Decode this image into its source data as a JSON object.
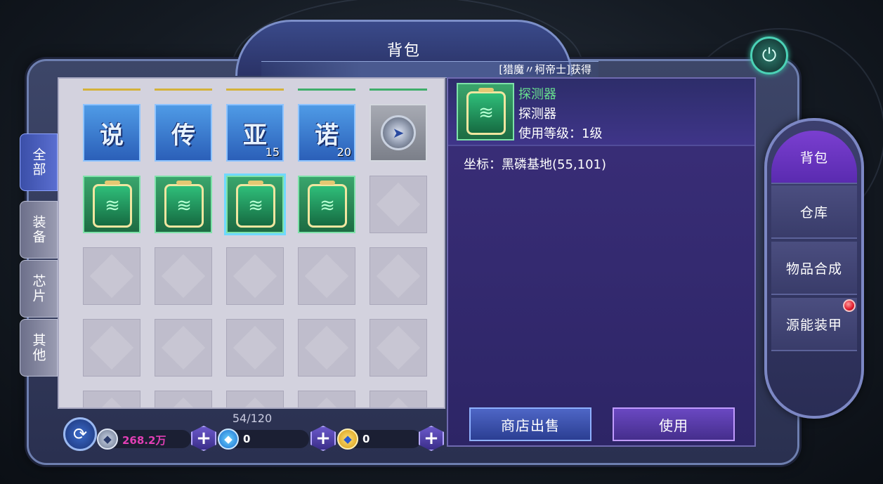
{
  "window": {
    "title": "背包"
  },
  "news_ticker": "[猎魔〃柯帝士]获得",
  "tabs": [
    {
      "label": "全部",
      "active": true
    },
    {
      "label": "装备",
      "active": false
    },
    {
      "label": "芯片",
      "active": false
    },
    {
      "label": "其他",
      "active": false
    }
  ],
  "inventory": {
    "capacity": "54/120",
    "rows": [
      [
        {
          "type": "card",
          "glyph": "说",
          "count": ""
        },
        {
          "type": "card",
          "glyph": "传",
          "count": ""
        },
        {
          "type": "card",
          "glyph": "亚",
          "count": "15"
        },
        {
          "type": "card",
          "glyph": "诺",
          "count": "20"
        },
        {
          "type": "compass",
          "glyph": "",
          "count": ""
        }
      ],
      [
        {
          "type": "detector",
          "glyph": "",
          "count": ""
        },
        {
          "type": "detector",
          "glyph": "",
          "count": ""
        },
        {
          "type": "detector",
          "glyph": "",
          "count": "",
          "selected": true
        },
        {
          "type": "detector",
          "glyph": "",
          "count": ""
        },
        {
          "type": "empty"
        }
      ]
    ],
    "rarity_colors": [
      "#d4b23a",
      "#d4b23a",
      "#d4b23a",
      "#3fae6a",
      "#3fae6a"
    ]
  },
  "currency": {
    "gold_value": "268.2万",
    "diamond_blue_value": "0",
    "diamond_gold_value": "0",
    "gold_color": "#e23fb5"
  },
  "detail": {
    "name_colored": "探测器",
    "name": "探测器",
    "level": "使用等级：1级",
    "coords": "坐标：黑磷基地(55,101)"
  },
  "buttons": {
    "sell": "商店出售",
    "use": "使用"
  },
  "right_menu": [
    {
      "label": "背包",
      "active": true
    },
    {
      "label": "仓库",
      "active": false
    },
    {
      "label": "物品合成",
      "active": false
    },
    {
      "label": "源能装甲",
      "active": false
    }
  ]
}
